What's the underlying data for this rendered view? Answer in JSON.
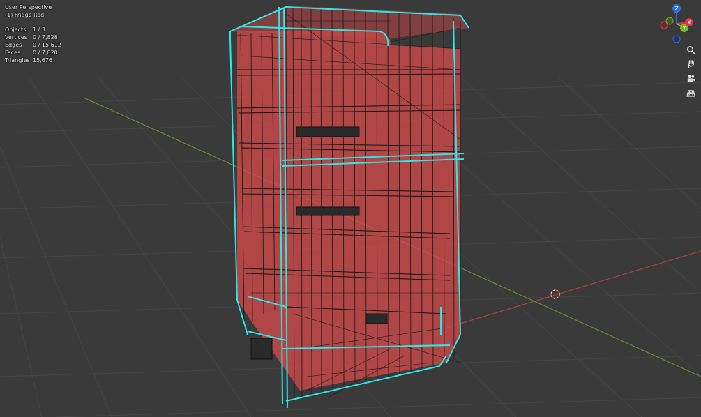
{
  "viewport": {
    "view_name": "User Perspective",
    "active_object": "(1) Fridge Red",
    "stats": [
      {
        "label": "Objects",
        "value": "1 / 3"
      },
      {
        "label": "Vertices",
        "value": "0 / 7,828"
      },
      {
        "label": "Edges",
        "value": "0 / 15,612"
      },
      {
        "label": "Faces",
        "value": "0 / 7,820"
      },
      {
        "label": "Triangles",
        "value": "15,676"
      }
    ]
  },
  "gizmo": {
    "axes": [
      {
        "label": "Z",
        "color": "#2f6fe0"
      },
      {
        "label": "Y",
        "color": "#7bb32e"
      },
      {
        "label": "X",
        "color": "#e0344a"
      }
    ]
  },
  "nav_buttons": [
    "zoom-icon",
    "hand-pan-icon",
    "camera-icon",
    "grid-ortho-icon"
  ],
  "colors": {
    "background": "#3a3a3a",
    "grid": "#454545",
    "wire": "#111111",
    "selection": "#2fe6e6",
    "fill": "#d24a4a"
  }
}
